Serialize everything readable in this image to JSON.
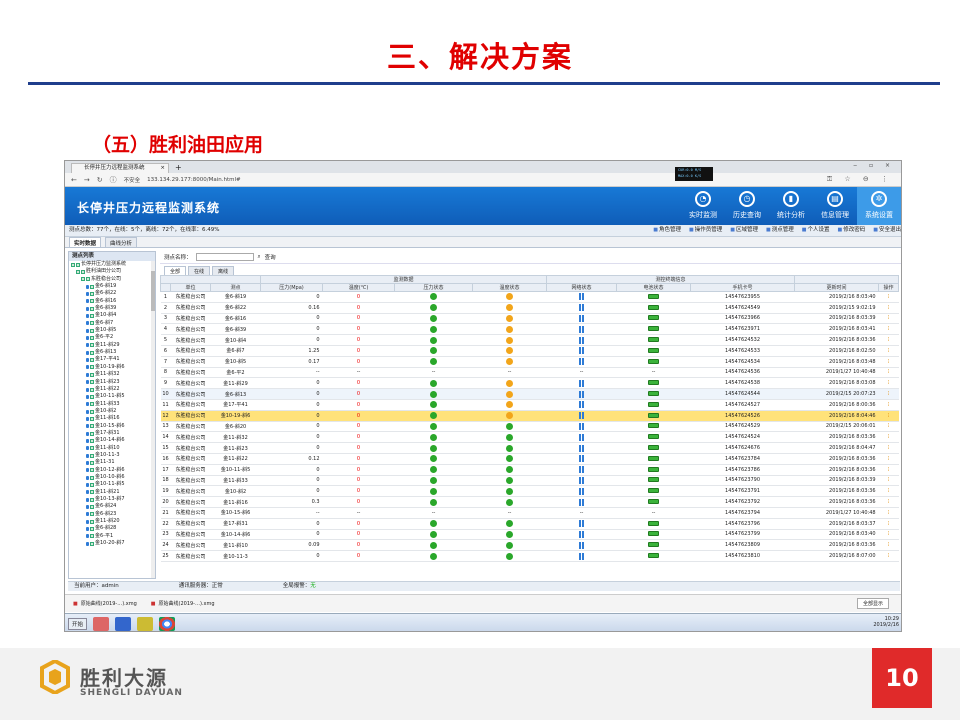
{
  "slide": {
    "title": "三、解决方案",
    "subtitle": "（五）胜利油田应用",
    "page_number": "10",
    "logo_cn": "胜利大源",
    "logo_en": "SHENGLI DAYUAN"
  },
  "browser": {
    "tab_title": "长停井压力远程监测系统",
    "url": "133.134.29.177:8000/Main.html#",
    "security_label": "不安全",
    "cpu_overlay": "CUR:0.0 M/S MAX:0.0 K/S"
  },
  "app": {
    "title": "长停井压力远程监测系统",
    "nav": [
      {
        "label": "实时监测",
        "icon": "gauge-icon"
      },
      {
        "label": "历史查询",
        "icon": "clock-icon"
      },
      {
        "label": "统计分析",
        "icon": "chart-icon"
      },
      {
        "label": "信息管理",
        "icon": "document-icon"
      },
      {
        "label": "系统设置",
        "icon": "gear-icon"
      }
    ],
    "summary": "测点总数：77个，在线：5个，离线：72个，在线率：6.49%",
    "toolbar": [
      "角色管理",
      "操作员管理",
      "区域管理",
      "测点管理",
      "个人设置"
    ],
    "toolbar_right": [
      "修改密码",
      "安全退出"
    ],
    "page_tabs": [
      "实时数据",
      "曲线分析"
    ],
    "tree_title": "测点列表",
    "filter_label": "测点名称：",
    "query_label": "查询",
    "sub_tabs": [
      "全部",
      "在线",
      "离线"
    ],
    "status": {
      "user": "当前用户：admin",
      "server": "通讯服务器：正常",
      "alarm_label": "全局报警：",
      "alarm_value": "无"
    }
  },
  "tree": [
    "长停井压力监测系统",
    "胜利油田分公司",
    "东胜稳台公司",
    "金6-斜19",
    "金6-斜22",
    "金6-斜16",
    "金6-斜39",
    "金10-斜4",
    "金6-斜7",
    "金10-斜5",
    "金6-平2",
    "金11-斜29",
    "金6-斜13",
    "金17-平41",
    "金10-19-斜6",
    "金11-斜32",
    "金11-斜23",
    "金11-斜22",
    "金10-11-斜5",
    "金11-斜33",
    "金10-斜2",
    "金11-斜16",
    "金10-15-斜6",
    "金17-斜31",
    "金10-14-斜6",
    "金11-斜10",
    "金10-11-3",
    "金11-31",
    "金10-12-斜6",
    "金10-10-斜6",
    "金10-11-斜5",
    "金11-斜21",
    "金10-13-斜7",
    "金6-斜24",
    "金6-斜23",
    "金11-斜20",
    "金6-斜28",
    "金6-平1",
    "金10-20-斜7"
  ],
  "table": {
    "group_headers": [
      "监测数据",
      "测控终端信息"
    ],
    "headers": [
      "",
      "单位",
      "测点",
      "压力(Mpa)",
      "温度(℃)",
      "压力状态",
      "温度状态",
      "网络状态",
      "电池状态",
      "手机卡号",
      "更新时间",
      "操作"
    ],
    "rows": [
      [
        "1",
        "东胜稳台公司",
        "金6-斜19",
        "0",
        "0",
        "g",
        "y",
        "a",
        "b",
        "14547623955",
        "2019/2/16 8:03:40"
      ],
      [
        "2",
        "东胜稳台公司",
        "金6-斜22",
        "0.16",
        "0",
        "g",
        "y",
        "a",
        "b",
        "14547624549",
        "2019/2/15 9:02:19"
      ],
      [
        "3",
        "东胜稳台公司",
        "金6-斜16",
        "0",
        "0",
        "g",
        "y",
        "a",
        "b",
        "14547623966",
        "2019/2/16 8:03:39"
      ],
      [
        "4",
        "东胜稳台公司",
        "金6-斜39",
        "0",
        "0",
        "g",
        "y",
        "a",
        "b",
        "14547623971",
        "2019/2/16 8:03:41"
      ],
      [
        "5",
        "东胜稳台公司",
        "金10-斜4",
        "0",
        "0",
        "g",
        "y",
        "a",
        "b",
        "14547624532",
        "2019/2/16 8:03:36"
      ],
      [
        "6",
        "东胜稳台公司",
        "金6-斜7",
        "1.25",
        "0",
        "g",
        "y",
        "a",
        "b",
        "14547624533",
        "2019/2/16 8:02:50"
      ],
      [
        "7",
        "东胜稳台公司",
        "金10-斜5",
        "0.17",
        "0",
        "g",
        "y",
        "a",
        "b",
        "14547624534",
        "2019/2/16 8:03:48"
      ],
      [
        "8",
        "东胜稳台公司",
        "金6-平2",
        "--",
        "--",
        "--",
        "--",
        "--",
        "--",
        "14547624536",
        "2019/1/27 10:40:48"
      ],
      [
        "9",
        "东胜稳台公司",
        "金11-斜29",
        "0",
        "0",
        "g",
        "y",
        "a",
        "b",
        "14547624538",
        "2019/2/16 8:03:08"
      ],
      [
        "10",
        "东胜稳台公司",
        "金6-斜13",
        "0",
        "0",
        "g",
        "y",
        "a",
        "b",
        "14547624544",
        "2019/2/15 20:07:23"
      ],
      [
        "11",
        "东胜稳台公司",
        "金17-平41",
        "0",
        "0",
        "g",
        "y",
        "a",
        "b",
        "14547624527",
        "2019/2/16 8:00:36"
      ],
      [
        "12",
        "东胜稳台公司",
        "金10-19-斜6",
        "0",
        "0",
        "g",
        "y",
        "a",
        "b",
        "14547624526",
        "2019/2/16 8:04:46"
      ],
      [
        "13",
        "东胜稳台公司",
        "金6-斜20",
        "0",
        "0",
        "g",
        "g",
        "a",
        "b",
        "14547624529",
        "2019/2/15 20:06:01"
      ],
      [
        "14",
        "东胜稳台公司",
        "金11-斜32",
        "0",
        "0",
        "g",
        "g",
        "a",
        "b",
        "14547624524",
        "2019/2/16 8:03:36"
      ],
      [
        "15",
        "东胜稳台公司",
        "金11-斜23",
        "0",
        "0",
        "g",
        "g",
        "a",
        "b",
        "14547624676",
        "2019/2/16 8:04:47"
      ],
      [
        "16",
        "东胜稳台公司",
        "金11-斜22",
        "0.12",
        "0",
        "g",
        "g",
        "a",
        "b",
        "14547623784",
        "2019/2/16 8:03:36"
      ],
      [
        "17",
        "东胜稳台公司",
        "金10-11-斜5",
        "0",
        "0",
        "g",
        "g",
        "a",
        "b",
        "14547623786",
        "2019/2/16 8:03:36"
      ],
      [
        "18",
        "东胜稳台公司",
        "金11-斜33",
        "0",
        "0",
        "g",
        "g",
        "a",
        "b",
        "14547623790",
        "2019/2/16 8:03:39"
      ],
      [
        "19",
        "东胜稳台公司",
        "金10-斜2",
        "0",
        "0",
        "g",
        "g",
        "a",
        "b",
        "14547623791",
        "2019/2/16 8:03:36"
      ],
      [
        "20",
        "东胜稳台公司",
        "金11-斜16",
        "0.3",
        "0",
        "g",
        "g",
        "a",
        "b",
        "14547623792",
        "2019/2/16 8:03:36"
      ],
      [
        "21",
        "东胜稳台公司",
        "金10-15-斜6",
        "--",
        "--",
        "--",
        "--",
        "--",
        "--",
        "14547623794",
        "2019/1/27 10:40:48"
      ],
      [
        "22",
        "东胜稳台公司",
        "金17-斜31",
        "0",
        "0",
        "g",
        "g",
        "a",
        "b",
        "14547623796",
        "2019/2/16 8:03:37"
      ],
      [
        "23",
        "东胜稳台公司",
        "金10-14-斜6",
        "0",
        "0",
        "g",
        "g",
        "a",
        "b",
        "14547623799",
        "2019/2/16 8:03:40"
      ],
      [
        "24",
        "东胜稳台公司",
        "金11-斜10",
        "0.09",
        "0",
        "g",
        "g",
        "a",
        "b",
        "14547623809",
        "2019/2/16 8:03:36"
      ],
      [
        "25",
        "东胜稳台公司",
        "金10-11-3",
        "0",
        "0",
        "g",
        "g",
        "a",
        "b",
        "14547623810",
        "2019/2/16 8:07:00"
      ]
    ],
    "selected_row": 12
  },
  "downloads": [
    "原始曲线(2019-…).xmg",
    "原始曲线(2019-…).xmg"
  ],
  "downloads_show_all": "全部显示",
  "taskbar": {
    "start": "开始",
    "time": "10:29",
    "date": "2019/2/16"
  },
  "colors": {
    "accent": "#1879d6",
    "title_red": "#e00000",
    "selected_row": "#ffe27a",
    "online_green": "#2aa72a",
    "warn_orange": "#f2a51a"
  }
}
